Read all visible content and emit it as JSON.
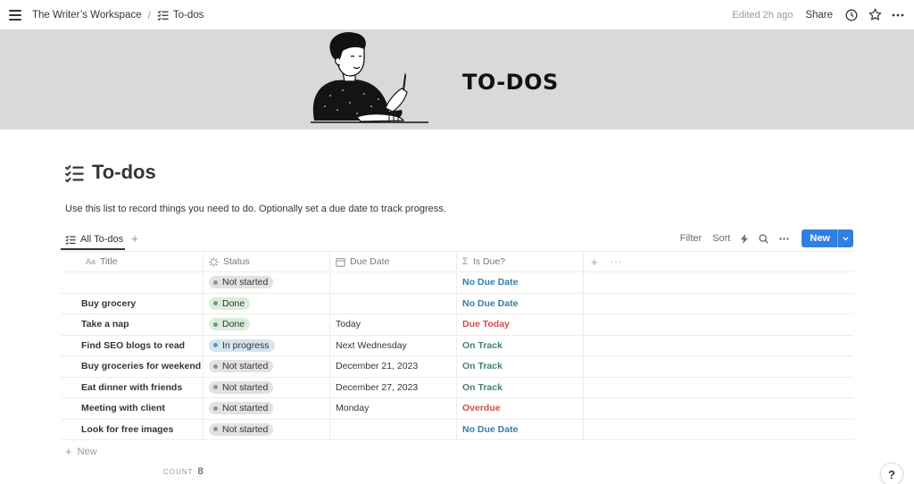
{
  "topbar": {
    "workspace": "The Writer’s Workspace",
    "separator": "/",
    "page": "To-dos",
    "edited": "Edited 2h ago",
    "share": "Share"
  },
  "cover": {
    "title": "TO-DOS"
  },
  "page": {
    "title": "To-dos",
    "description": "Use this list to record things you need to do. Optionally set a due date to track progress."
  },
  "view": {
    "tab": "All To-dos",
    "filter": "Filter",
    "sort": "Sort",
    "new_button": "New"
  },
  "table": {
    "columns": {
      "title_prefix": "Aa",
      "title": "Title",
      "status": "Status",
      "due_date": "Due Date",
      "is_due_prefix": "Σ",
      "is_due": "Is Due?"
    },
    "rows": [
      {
        "title": "",
        "status": "Not started",
        "due_date": "",
        "is_due": "No Due Date"
      },
      {
        "title": "Buy grocery",
        "status": "Done",
        "due_date": "",
        "is_due": "No Due Date"
      },
      {
        "title": "Take a nap",
        "status": "Done",
        "due_date": "Today",
        "is_due": "Due Today"
      },
      {
        "title": "Find SEO blogs to read",
        "status": "In progress",
        "due_date": "Next Wednesday",
        "is_due": "On Track"
      },
      {
        "title": "Buy groceries for weekend",
        "status": "Not started",
        "due_date": "December 21, 2023",
        "is_due": "On Track"
      },
      {
        "title": "Eat dinner with friends",
        "status": "Not started",
        "due_date": "December 27, 2023",
        "is_due": "On Track"
      },
      {
        "title": "Meeting with client",
        "status": "Not started",
        "due_date": "Monday",
        "is_due": "Overdue"
      },
      {
        "title": "Look for free images",
        "status": "Not started",
        "due_date": "",
        "is_due": "No Due Date"
      }
    ],
    "new_row": "New",
    "count_label": "COUNT",
    "count_value": "8"
  },
  "help": "?",
  "colors": {
    "accent": "#2f80e0",
    "no_due": "#337ea9",
    "on_track": "#448361",
    "overdue": "#d44c47",
    "cover_bg": "#d9d9d9"
  }
}
